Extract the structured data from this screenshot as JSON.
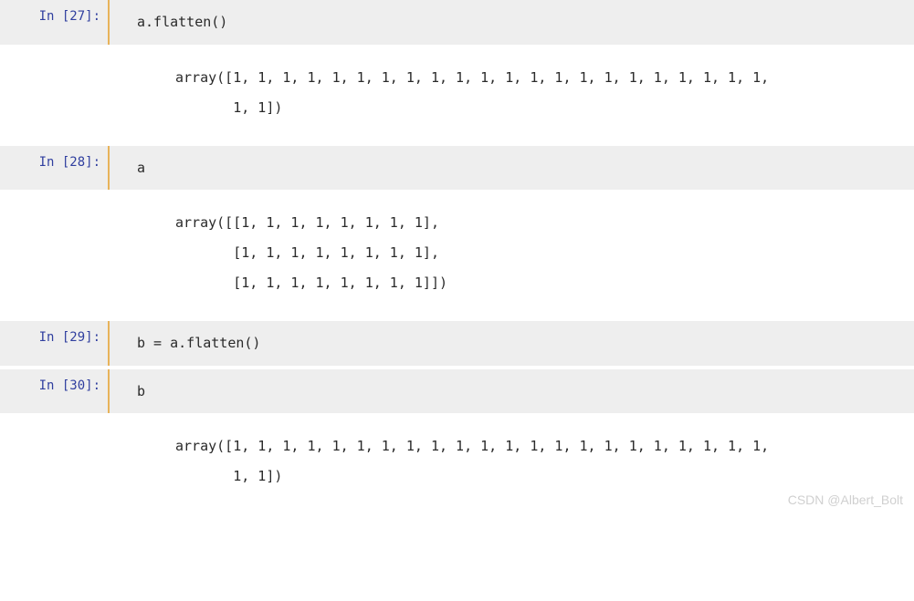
{
  "cells": [
    {
      "type": "input",
      "prompt": "In [27]:",
      "content": "a.flatten()"
    },
    {
      "type": "output",
      "content": "array([1, 1, 1, 1, 1, 1, 1, 1, 1, 1, 1, 1, 1, 1, 1, 1, 1, 1, 1, 1, 1, 1,\n       1, 1])"
    },
    {
      "type": "input",
      "prompt": "In [28]:",
      "content": "a"
    },
    {
      "type": "output",
      "content": "array([[1, 1, 1, 1, 1, 1, 1, 1],\n       [1, 1, 1, 1, 1, 1, 1, 1],\n       [1, 1, 1, 1, 1, 1, 1, 1]])"
    },
    {
      "type": "input",
      "prompt": "In [29]:",
      "content": "b = a.flatten()"
    },
    {
      "type": "input",
      "prompt": "In [30]:",
      "content": "b"
    },
    {
      "type": "output",
      "content": "array([1, 1, 1, 1, 1, 1, 1, 1, 1, 1, 1, 1, 1, 1, 1, 1, 1, 1, 1, 1, 1, 1,\n       1, 1])"
    }
  ],
  "watermark": "CSDN @Albert_Bolt"
}
